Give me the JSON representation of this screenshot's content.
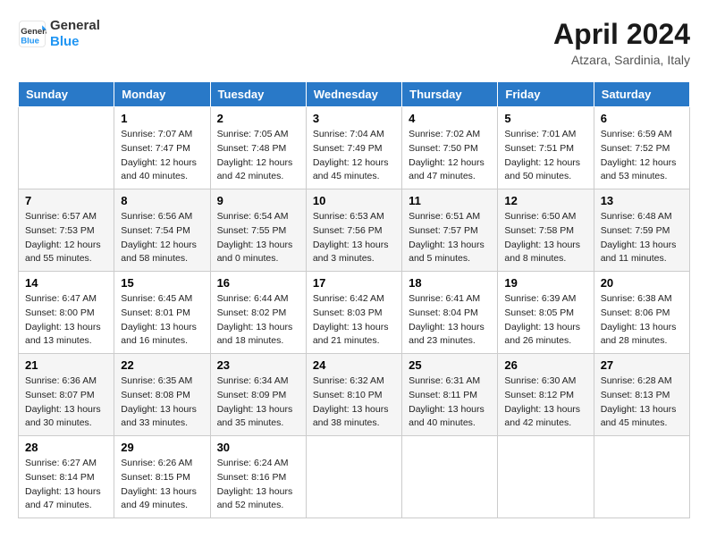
{
  "header": {
    "logo_line1": "General",
    "logo_line2": "Blue",
    "month_title": "April 2024",
    "location": "Atzara, Sardinia, Italy"
  },
  "days_of_week": [
    "Sunday",
    "Monday",
    "Tuesday",
    "Wednesday",
    "Thursday",
    "Friday",
    "Saturday"
  ],
  "weeks": [
    [
      {
        "day": null,
        "info": null
      },
      {
        "day": "1",
        "info": "Sunrise: 7:07 AM\nSunset: 7:47 PM\nDaylight: 12 hours\nand 40 minutes."
      },
      {
        "day": "2",
        "info": "Sunrise: 7:05 AM\nSunset: 7:48 PM\nDaylight: 12 hours\nand 42 minutes."
      },
      {
        "day": "3",
        "info": "Sunrise: 7:04 AM\nSunset: 7:49 PM\nDaylight: 12 hours\nand 45 minutes."
      },
      {
        "day": "4",
        "info": "Sunrise: 7:02 AM\nSunset: 7:50 PM\nDaylight: 12 hours\nand 47 minutes."
      },
      {
        "day": "5",
        "info": "Sunrise: 7:01 AM\nSunset: 7:51 PM\nDaylight: 12 hours\nand 50 minutes."
      },
      {
        "day": "6",
        "info": "Sunrise: 6:59 AM\nSunset: 7:52 PM\nDaylight: 12 hours\nand 53 minutes."
      }
    ],
    [
      {
        "day": "7",
        "info": "Sunrise: 6:57 AM\nSunset: 7:53 PM\nDaylight: 12 hours\nand 55 minutes."
      },
      {
        "day": "8",
        "info": "Sunrise: 6:56 AM\nSunset: 7:54 PM\nDaylight: 12 hours\nand 58 minutes."
      },
      {
        "day": "9",
        "info": "Sunrise: 6:54 AM\nSunset: 7:55 PM\nDaylight: 13 hours\nand 0 minutes."
      },
      {
        "day": "10",
        "info": "Sunrise: 6:53 AM\nSunset: 7:56 PM\nDaylight: 13 hours\nand 3 minutes."
      },
      {
        "day": "11",
        "info": "Sunrise: 6:51 AM\nSunset: 7:57 PM\nDaylight: 13 hours\nand 5 minutes."
      },
      {
        "day": "12",
        "info": "Sunrise: 6:50 AM\nSunset: 7:58 PM\nDaylight: 13 hours\nand 8 minutes."
      },
      {
        "day": "13",
        "info": "Sunrise: 6:48 AM\nSunset: 7:59 PM\nDaylight: 13 hours\nand 11 minutes."
      }
    ],
    [
      {
        "day": "14",
        "info": "Sunrise: 6:47 AM\nSunset: 8:00 PM\nDaylight: 13 hours\nand 13 minutes."
      },
      {
        "day": "15",
        "info": "Sunrise: 6:45 AM\nSunset: 8:01 PM\nDaylight: 13 hours\nand 16 minutes."
      },
      {
        "day": "16",
        "info": "Sunrise: 6:44 AM\nSunset: 8:02 PM\nDaylight: 13 hours\nand 18 minutes."
      },
      {
        "day": "17",
        "info": "Sunrise: 6:42 AM\nSunset: 8:03 PM\nDaylight: 13 hours\nand 21 minutes."
      },
      {
        "day": "18",
        "info": "Sunrise: 6:41 AM\nSunset: 8:04 PM\nDaylight: 13 hours\nand 23 minutes."
      },
      {
        "day": "19",
        "info": "Sunrise: 6:39 AM\nSunset: 8:05 PM\nDaylight: 13 hours\nand 26 minutes."
      },
      {
        "day": "20",
        "info": "Sunrise: 6:38 AM\nSunset: 8:06 PM\nDaylight: 13 hours\nand 28 minutes."
      }
    ],
    [
      {
        "day": "21",
        "info": "Sunrise: 6:36 AM\nSunset: 8:07 PM\nDaylight: 13 hours\nand 30 minutes."
      },
      {
        "day": "22",
        "info": "Sunrise: 6:35 AM\nSunset: 8:08 PM\nDaylight: 13 hours\nand 33 minutes."
      },
      {
        "day": "23",
        "info": "Sunrise: 6:34 AM\nSunset: 8:09 PM\nDaylight: 13 hours\nand 35 minutes."
      },
      {
        "day": "24",
        "info": "Sunrise: 6:32 AM\nSunset: 8:10 PM\nDaylight: 13 hours\nand 38 minutes."
      },
      {
        "day": "25",
        "info": "Sunrise: 6:31 AM\nSunset: 8:11 PM\nDaylight: 13 hours\nand 40 minutes."
      },
      {
        "day": "26",
        "info": "Sunrise: 6:30 AM\nSunset: 8:12 PM\nDaylight: 13 hours\nand 42 minutes."
      },
      {
        "day": "27",
        "info": "Sunrise: 6:28 AM\nSunset: 8:13 PM\nDaylight: 13 hours\nand 45 minutes."
      }
    ],
    [
      {
        "day": "28",
        "info": "Sunrise: 6:27 AM\nSunset: 8:14 PM\nDaylight: 13 hours\nand 47 minutes."
      },
      {
        "day": "29",
        "info": "Sunrise: 6:26 AM\nSunset: 8:15 PM\nDaylight: 13 hours\nand 49 minutes."
      },
      {
        "day": "30",
        "info": "Sunrise: 6:24 AM\nSunset: 8:16 PM\nDaylight: 13 hours\nand 52 minutes."
      },
      {
        "day": null,
        "info": null
      },
      {
        "day": null,
        "info": null
      },
      {
        "day": null,
        "info": null
      },
      {
        "day": null,
        "info": null
      }
    ]
  ]
}
